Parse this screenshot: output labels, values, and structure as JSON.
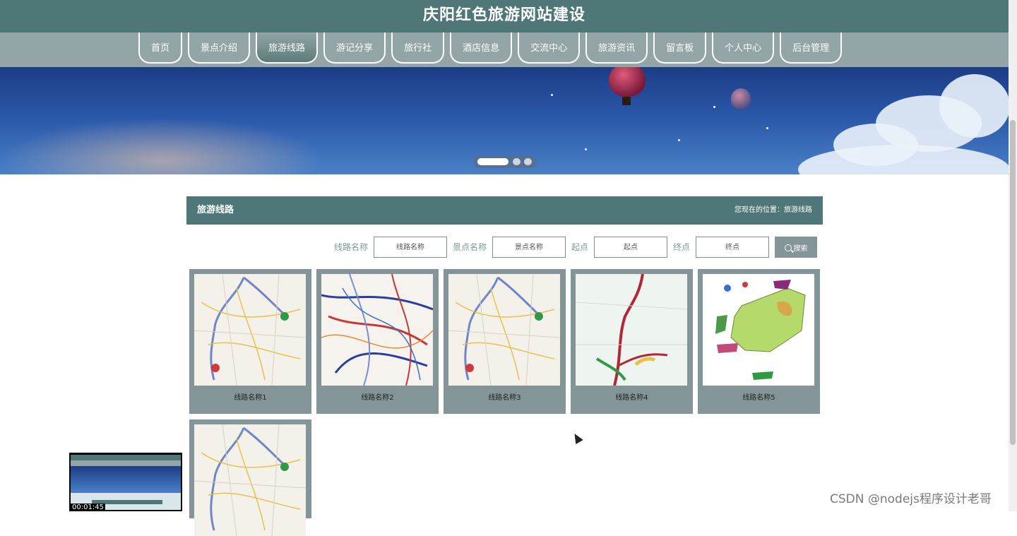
{
  "header": {
    "title": "庆阳红色旅游网站建设"
  },
  "nav": {
    "items": [
      {
        "label": "首页"
      },
      {
        "label": "景点介绍"
      },
      {
        "label": "旅游线路",
        "active": true
      },
      {
        "label": "游记分享"
      },
      {
        "label": "旅行社"
      },
      {
        "label": "酒店信息"
      },
      {
        "label": "交流中心"
      },
      {
        "label": "旅游资讯"
      },
      {
        "label": "留言板"
      },
      {
        "label": "个人中心"
      },
      {
        "label": "后台管理"
      }
    ]
  },
  "banner": {
    "active_slide": 1,
    "slide_count": 3
  },
  "section": {
    "title": "旅游线路",
    "breadcrumb": "您现在的位置：旅游线路"
  },
  "search": {
    "route_label": "线路名称",
    "route_placeholder": "线路名称",
    "scenic_label": "景点名称",
    "scenic_placeholder": "景点名称",
    "start_label": "起点",
    "start_placeholder": "起点",
    "end_label": "终点",
    "end_placeholder": "终点",
    "button_label": "搜索"
  },
  "routes": [
    {
      "name": "线路名称1",
      "map": "road-map"
    },
    {
      "name": "线路名称2",
      "map": "network-map"
    },
    {
      "name": "线路名称3",
      "map": "road-map"
    },
    {
      "name": "线路名称4",
      "map": "line-map"
    },
    {
      "name": "线路名称5",
      "map": "region-map"
    },
    {
      "name": "",
      "map": "road-map"
    }
  ],
  "video": {
    "time": "00:01:45"
  },
  "watermark": "CSDN @nodejs程序设计老哥",
  "colors": {
    "header_bg": "#4f7777",
    "nav_bg": "#93a5a6",
    "card_bg": "#849597",
    "label": "#7e9a9a"
  }
}
